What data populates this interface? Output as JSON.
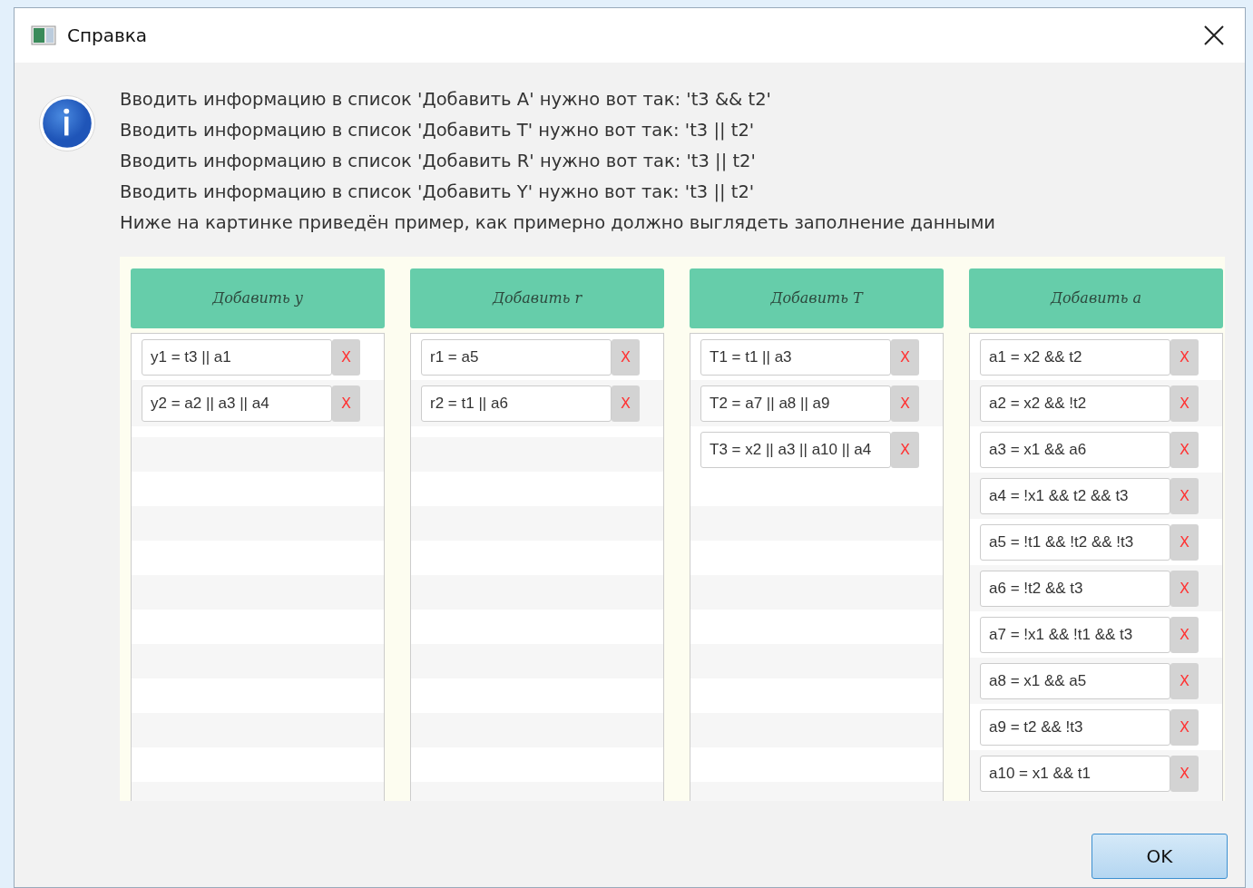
{
  "window": {
    "title": "Справка"
  },
  "message_lines": [
    "Вводить информацию в список 'Добавить A' нужно вот так: 't3 && t2'",
    "Вводить информацию в список 'Добавить T' нужно вот так: 't3 || t2'",
    "Вводить информацию в список 'Добавить R' нужно вот так: 't3 || t2'",
    "Вводить информацию в список 'Добавить Y' нужно вот так: 't3 || t2'",
    "Ниже на картинке приведён пример, как примерно должно выглядеть заполнение данными"
  ],
  "example": {
    "columns": [
      {
        "header": "Добавить y",
        "entries": [
          {
            "value": "y1 = t3 || a1",
            "remove": "X"
          },
          {
            "value": "y2 = a2 || a3 || a4",
            "remove": "X"
          }
        ]
      },
      {
        "header": "Добавить r",
        "entries": [
          {
            "value": "r1 = a5",
            "remove": "X"
          },
          {
            "value": "r2 = t1 || a6",
            "remove": "X"
          }
        ]
      },
      {
        "header": "Добавить T",
        "entries": [
          {
            "value": "T1 = t1 || a3",
            "remove": "X"
          },
          {
            "value": "T2 = a7 || a8 || a9",
            "remove": "X"
          },
          {
            "value": "T3 = x2 || a3 || a10 || a4",
            "remove": "X"
          }
        ]
      },
      {
        "header": "Добавить a",
        "entries": [
          {
            "value": "a1 = x2 && t2",
            "remove": "X"
          },
          {
            "value": "a2 = x2 && !t2",
            "remove": "X"
          },
          {
            "value": "a3 = x1 && a6",
            "remove": "X"
          },
          {
            "value": "a4 = !x1 && t2 && t3",
            "remove": "X"
          },
          {
            "value": "a5 = !t1 && !t2 && !t3",
            "remove": "X"
          },
          {
            "value": "a6 = !t2 && t3",
            "remove": "X"
          },
          {
            "value": "a7 = !x1 && !t1 && t3",
            "remove": "X"
          },
          {
            "value": "a8 = x1 && a5",
            "remove": "X"
          },
          {
            "value": "a9 = t2 && !t3",
            "remove": "X"
          },
          {
            "value": "a10 = x1 && t1",
            "remove": "X"
          }
        ]
      }
    ]
  },
  "buttons": [
    {
      "label": "OK"
    }
  ]
}
